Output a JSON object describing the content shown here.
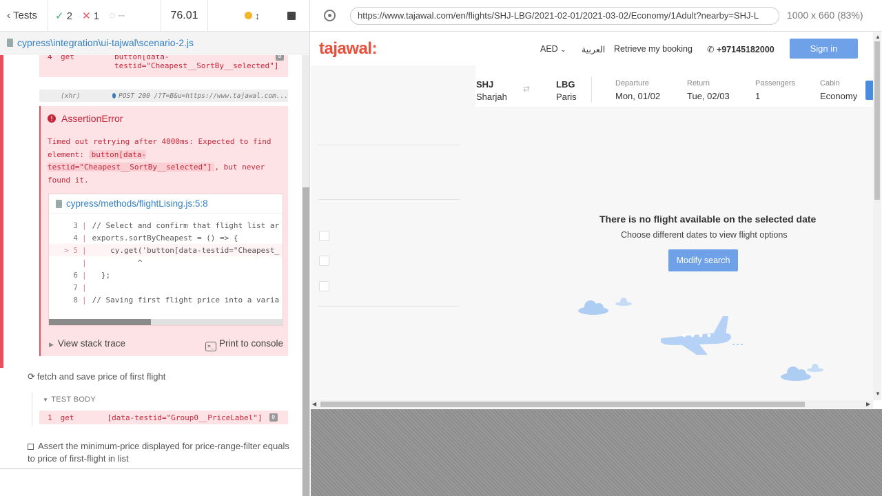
{
  "stats": {
    "tests_label": "Tests",
    "passed": "2",
    "failed": "1",
    "pending": "--",
    "duration": "76.01"
  },
  "spec": {
    "path": "cypress\\integration\\ui-tajwal\\scenario-2.js"
  },
  "log": {
    "cmd4": {
      "num": "4",
      "name": "get",
      "message": "button[data-testid=\"Cheapest__SortBy__selected\"]"
    },
    "xhr": {
      "name": "(xhr)",
      "message": "POST 200 /?T=B&u=https://www.tajawal.com..."
    },
    "error": {
      "title": "AssertionError",
      "msg_prefix": "Timed out retrying after 4000ms: Expected to find element: ",
      "msg_code": "button[data-testid=\"Cheapest__SortBy__selected\"]",
      "msg_suffix": ", but never found it.",
      "file": "cypress/methods/flightLising.js:5:8",
      "code_lines": [
        {
          "num": "3",
          "text": "// Select and confirm that flight list ar"
        },
        {
          "num": "4",
          "text": "exports.sortByCheapest = () => {"
        },
        {
          "num": "> 5",
          "text": "    cy.get('button[data-testid=\"Cheapest_"
        },
        {
          "num": "",
          "text": "          ^"
        },
        {
          "num": "6",
          "text": "  };"
        },
        {
          "num": "7",
          "text": ""
        },
        {
          "num": "8",
          "text": "// Saving first flight price into a varia"
        }
      ],
      "view_stack": "View stack trace",
      "print_console": "Print to console",
      "term_glyph": ">_"
    },
    "test2": {
      "title": "fetch and save price of first flight"
    },
    "test_body": "TEST BODY",
    "cmd1": {
      "num": "1",
      "name": "get",
      "message": "[data-testid=\"Group0__PriceLabel\"]"
    },
    "test3": {
      "title": "Assert the minimum-price displayed for price-range-filter equals to price of first-flight in list"
    }
  },
  "aut": {
    "url": "https://www.tajawal.com/en/flights/SHJ-LBG/2021-02-01/2021-03-02/Economy/1Adult?nearby=SHJ-L",
    "viewport": "1000 x 660",
    "scale": "(83%)"
  },
  "site": {
    "logo": "tajawal:",
    "currency": "AED",
    "lang": "العربية",
    "retrieve": "Retrieve my booking",
    "phone": "+97145182000",
    "signin": "Sign in",
    "search": {
      "from_code": "SHJ",
      "from_city": "Sharjah",
      "to_code": "LBG",
      "to_city": "Paris",
      "dep_label": "Departure",
      "dep_value": "Mon, 01/02",
      "ret_label": "Return",
      "ret_value": "Tue, 02/03",
      "pax_label": "Passengers",
      "pax_value": "1",
      "cabin_label": "Cabin",
      "cabin_value": "Economy"
    },
    "empty_title": "There is no flight available on the selected date",
    "empty_sub": "Choose different dates to view flight options",
    "modify": "Modify search"
  }
}
